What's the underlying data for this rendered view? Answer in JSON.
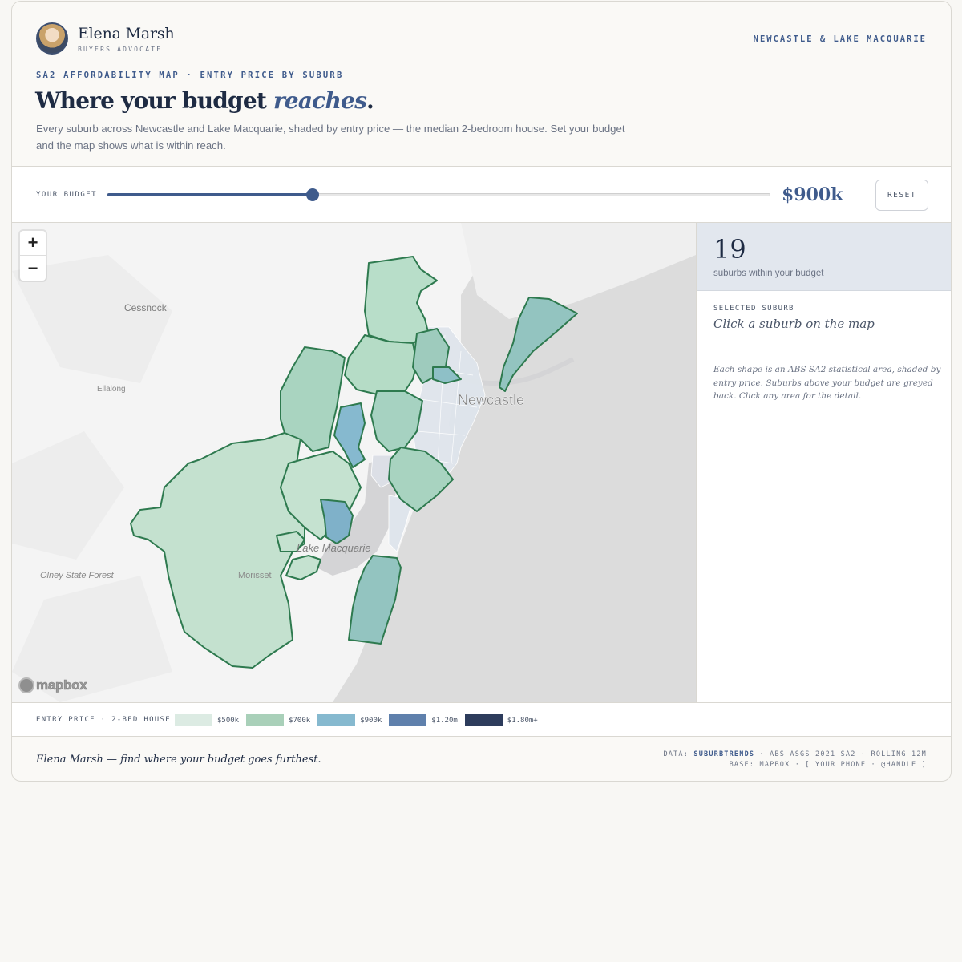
{
  "brand": {
    "name": "Elena Marsh",
    "role": "BUYERS ADVOCATE",
    "region": "NEWCASTLE & LAKE MACQUARIE"
  },
  "header": {
    "eyebrow": "SA2 AFFORDABILITY MAP · ENTRY PRICE BY SUBURB",
    "title_main": "Where your budget ",
    "title_accent": "reaches",
    "title_end": ".",
    "intro": "Every suburb across Newcastle and Lake Macquarie, shaded by entry price — the median 2-bedroom house. Set your budget and the map shows what is within reach."
  },
  "budget": {
    "label": "YOUR BUDGET",
    "value_label": "$900k",
    "slider_fraction": 0.31,
    "reset_label": "RESET"
  },
  "map": {
    "zoom_in": "+",
    "zoom_out": "−",
    "places": {
      "cessnock": "Cessnock",
      "ellalong": "Ellalong",
      "newcastle": "Newcastle",
      "lake": "Lake Macquarie",
      "olney": "Olney State Forest",
      "morisset": "Morisset"
    },
    "attribution": "mapbox"
  },
  "panel": {
    "count": "19",
    "count_label": "suburbs within your budget",
    "selected_label": "SELECTED SUBURB",
    "selected_value": "Click a suburb on the map",
    "note": "Each shape is an ABS SA2 statistical area, shaded by entry price. Suburbs above your budget are greyed back. Click any area for the detail."
  },
  "legend": {
    "title": "ENTRY PRICE · 2-BED HOUSE",
    "items": [
      {
        "label": "$500k",
        "color": "#dcebe3"
      },
      {
        "label": "$700k",
        "color": "#a9d0b9"
      },
      {
        "label": "$900k",
        "color": "#86b9cf"
      },
      {
        "label": "$1.20m",
        "color": "#5f80ac"
      },
      {
        "label": "$1.80m+",
        "color": "#2d3c5c"
      }
    ]
  },
  "colors": {
    "accent": "#3f5b8c",
    "outline": "#2e7a4f"
  },
  "footer": {
    "tagline": "Elena Marsh — find where your budget goes furthest.",
    "data_prefix": "DATA: ",
    "data_source": "SUBURBTRENDS",
    "data_rest": " · ABS ASGS 2021 SA2 · ROLLING 12M",
    "base": "BASE: MAPBOX · [ YOUR PHONE · @HANDLE ]"
  }
}
